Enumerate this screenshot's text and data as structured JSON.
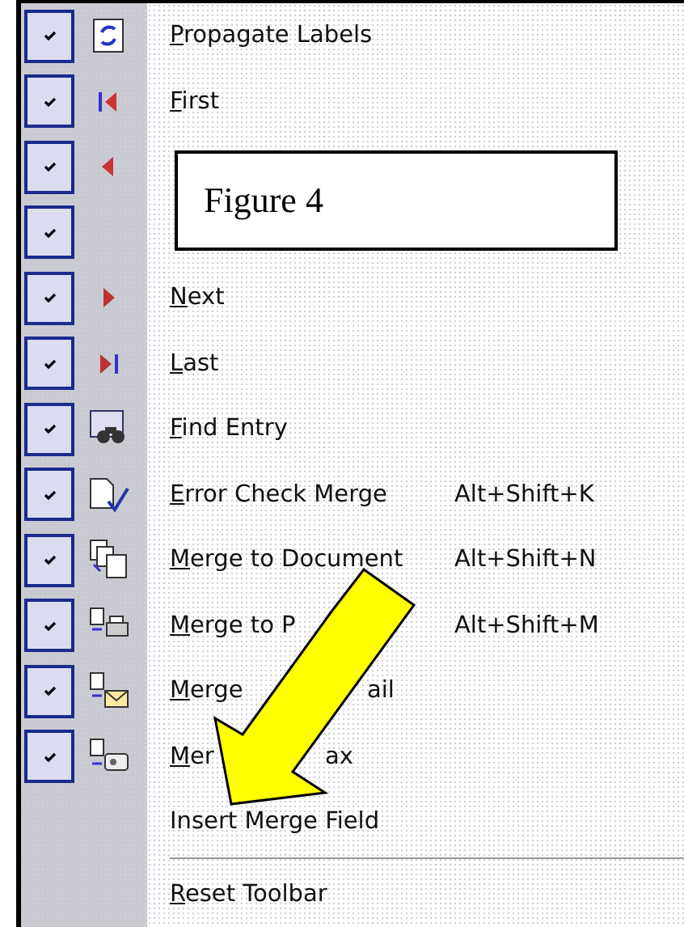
{
  "menu": {
    "items": [
      {
        "kind": "propagate",
        "label": "Propagate Labels",
        "mnemonic": true,
        "checked": true
      },
      {
        "kind": "first",
        "label": "First",
        "mnemonic": true,
        "checked": true
      },
      {
        "kind": "previous",
        "checked": true
      },
      {
        "kind": "field",
        "checked": true
      },
      {
        "kind": "next",
        "label": "Next",
        "mnemonic": true,
        "checked": true
      },
      {
        "kind": "last",
        "label": "Last",
        "mnemonic": true,
        "checked": true
      },
      {
        "kind": "find",
        "label": "Find Entry",
        "mnemonic": true,
        "checked": true
      },
      {
        "kind": "check",
        "label": "Error Check Merge",
        "mnemonic": true,
        "checked": true,
        "shortcut": "Alt+Shift+K"
      },
      {
        "kind": "document",
        "label": "Merge to Document",
        "mnemonic": true,
        "checked": true,
        "shortcut": "Alt+Shift+N"
      },
      {
        "kind": "printer",
        "label": "Merge to P",
        "mnemonic": true,
        "checked": true,
        "shortcut": "Alt+Shift+M"
      },
      {
        "kind": "email",
        "label": "Merge",
        "label_end": "ail",
        "mnemonic": true,
        "checked": true
      },
      {
        "kind": "fax",
        "label": "Mer",
        "label_end": "ax",
        "mnemonic": true,
        "checked": true
      },
      {
        "kind": "insert",
        "label": "Insert Merge Field",
        "mnemonic": false,
        "checked": false
      },
      {
        "kind": "separator"
      },
      {
        "kind": "reset",
        "label": "Reset Toolbar",
        "mnemonic": true,
        "checked": false
      }
    ]
  },
  "figure_label": "Figure 4"
}
